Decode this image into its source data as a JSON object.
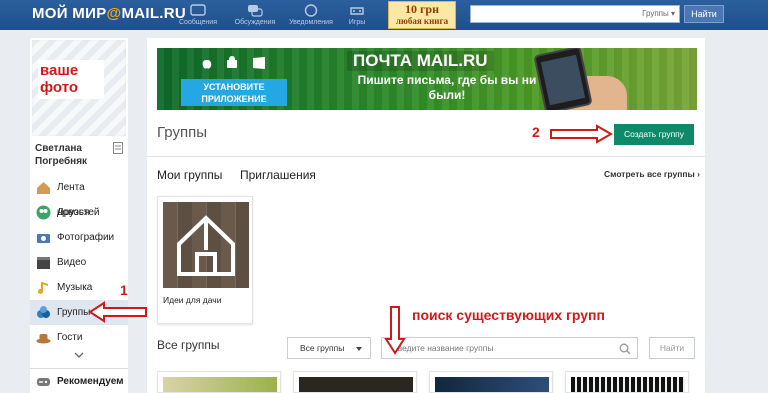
{
  "topbar": {
    "logo": {
      "part1": "МОЙ МИР",
      "at": "@",
      "part2": "MAIL.RU"
    },
    "nav": [
      {
        "label": "Сообщения",
        "icon": "messages-icon"
      },
      {
        "label": "Обсуждения",
        "icon": "discussions-icon"
      },
      {
        "label": "Уведомления",
        "icon": "notifications-icon"
      },
      {
        "label": "Игры",
        "icon": "games-icon"
      }
    ],
    "promo": {
      "price": "10 грн",
      "text": "любая книга"
    },
    "search": {
      "value": "",
      "scope": "Группы"
    },
    "find_label": "Найти"
  },
  "sidebar": {
    "photo_text": "ваше фото",
    "user_name": "Светлана Погребняк",
    "items": [
      {
        "label": "Лента новостей",
        "icon": "house-icon",
        "color": "#d39a58"
      },
      {
        "label": "Друзья",
        "icon": "friends-icon",
        "color": "#3aa56b"
      },
      {
        "label": "Фотографии",
        "icon": "camera-icon",
        "color": "#4b7bb0"
      },
      {
        "label": "Видео",
        "icon": "clapper-icon",
        "color": "#444444"
      },
      {
        "label": "Музыка",
        "icon": "music-note-icon",
        "color": "#e0a821"
      },
      {
        "label": "Группы",
        "icon": "groups-icon",
        "color": "#2f7fc2"
      },
      {
        "label": "Гости",
        "icon": "hat-icon",
        "color": "#b7773c"
      }
    ],
    "recommend_label": "Рекомендуем"
  },
  "banner": {
    "install": "УСТАНОВИТЕ ПРИЛОЖЕНИЕ",
    "title": "ПОЧТА MAIL.RU",
    "subtitle": "Пишите письма, где бы вы ни были!"
  },
  "main": {
    "title": "Группы",
    "create_label": "Создать группу",
    "tabs": [
      "Мои группы",
      "Приглашения"
    ],
    "see_all": "Смотреть все группы",
    "my_groups": [
      {
        "name": "Идеи для дачи"
      }
    ],
    "all_groups_title": "Все группы",
    "filter": {
      "selected": "Все группы"
    },
    "search": {
      "placeholder": "Введите название группы"
    },
    "find_label": "Найти"
  },
  "annotations": {
    "label_1": "1",
    "label_2": "2",
    "hint": "поиск существующих групп",
    "color": "#d01a1a"
  }
}
